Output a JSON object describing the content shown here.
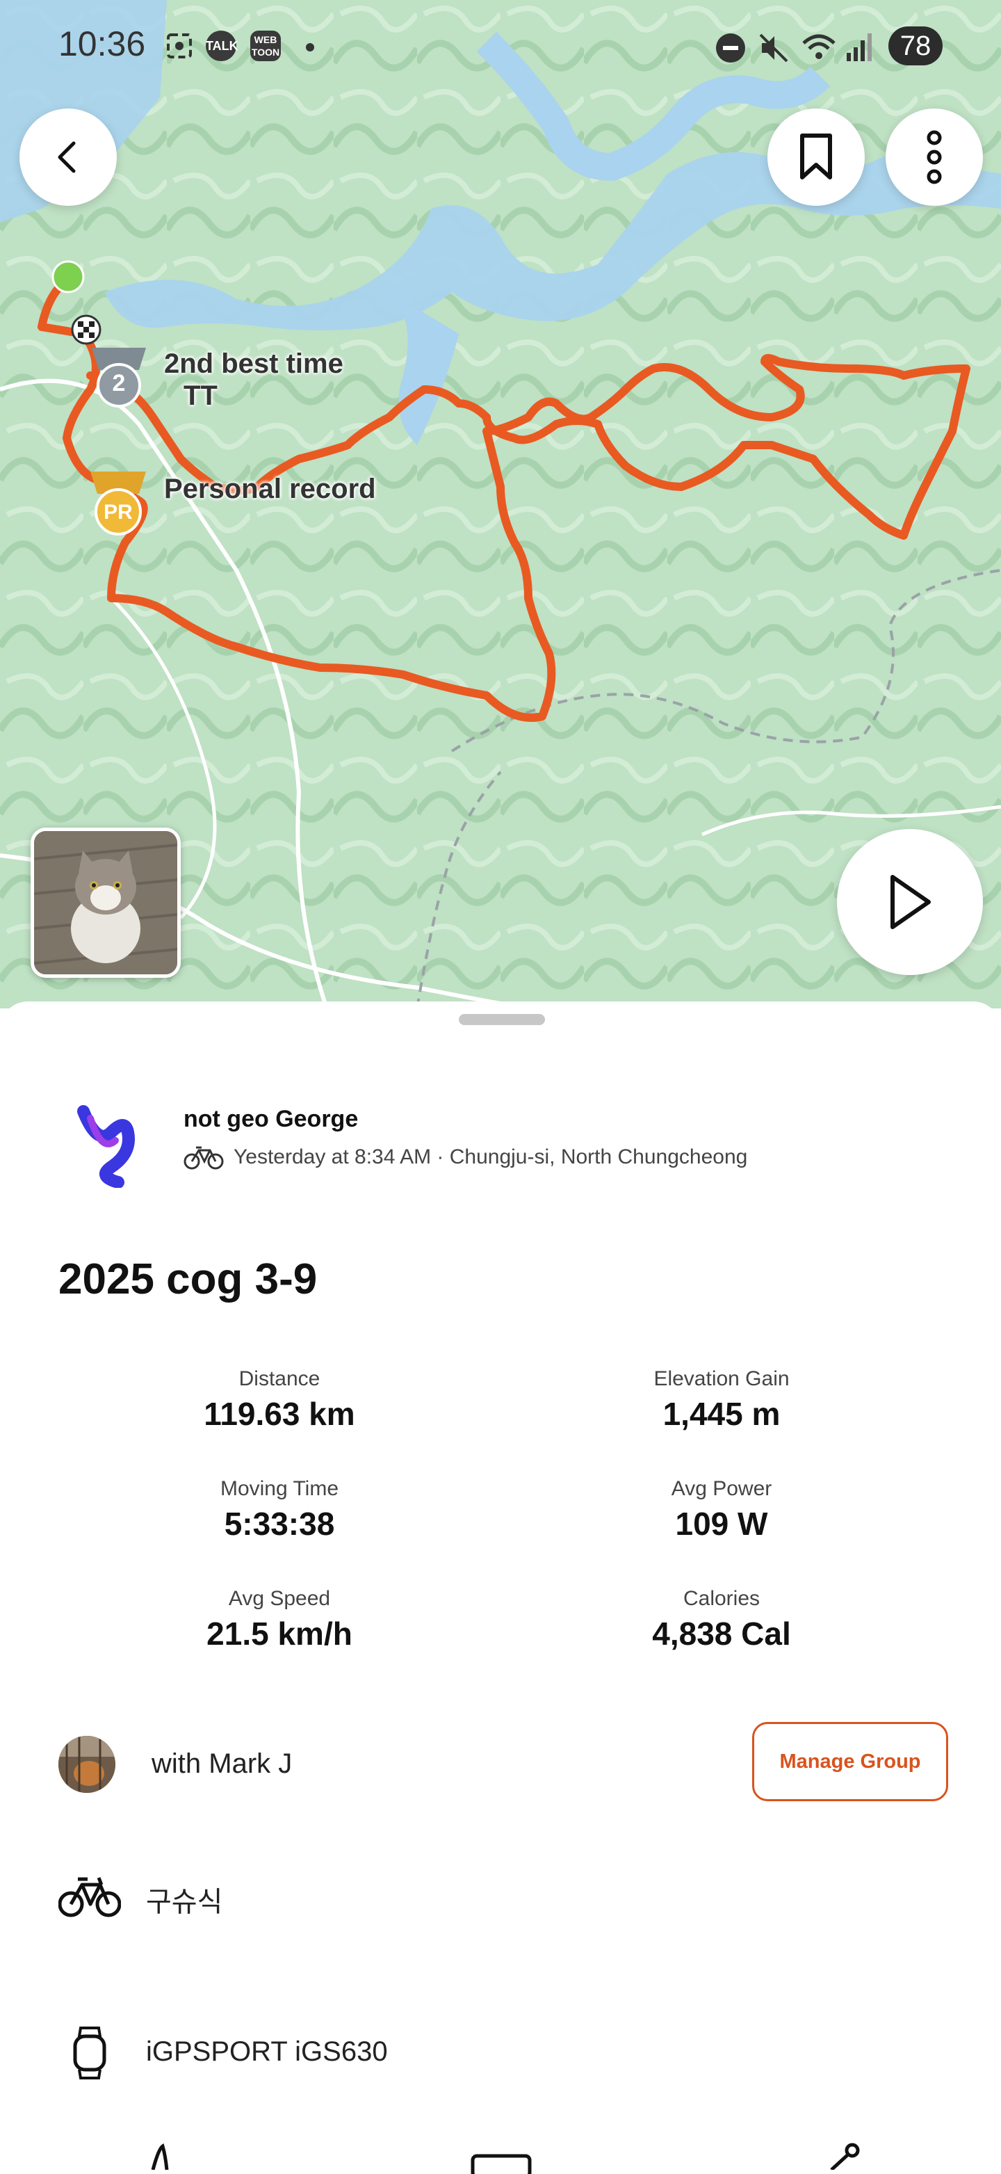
{
  "status_bar": {
    "time": "10:36",
    "battery": "78",
    "icons": [
      "screenshot-icon",
      "talk-icon",
      "webtoon-icon",
      "dot-icon",
      "dnd-icon",
      "mute-icon",
      "wifi-icon",
      "signal-icon"
    ],
    "talk_label": "TALK",
    "webtoon_label": "WEB TOON"
  },
  "map": {
    "back_icon": "chevron-left-icon",
    "bookmark_icon": "bookmark-icon",
    "more_icon": "more-vertical-icon",
    "play_icon": "play-icon",
    "label_best_time": "2nd best time\nTT",
    "label_best_time_line1": "2nd best time",
    "label_best_time_line2": "TT",
    "label_pr": "Personal record",
    "badge_2": "2",
    "badge_pr": "PR",
    "route_color": "#e85a22",
    "start_color": "#7ed04f"
  },
  "activity": {
    "athlete_name": "not geo George",
    "meta": "Yesterday at 8:34 AM · Chungju-si, North Chungcheong",
    "title": "2025 cog 3-9",
    "stats": [
      {
        "label": "Distance",
        "value": "119.63 km"
      },
      {
        "label": "Elevation Gain",
        "value": "1,445 m"
      },
      {
        "label": "Moving Time",
        "value": "5:33:38"
      },
      {
        "label": "Avg Power",
        "value": "109 W"
      },
      {
        "label": "Avg Speed",
        "value": "21.5 km/h"
      },
      {
        "label": "Calories",
        "value": "4,838 Cal"
      }
    ],
    "with_text": "with Mark J",
    "manage_group": "Manage Group",
    "bike": "구슈식",
    "device": "iGPSPORT iGS630"
  },
  "colors": {
    "accent": "#d9531e",
    "map_green": "#bfe1c4",
    "water": "#a9d3ee"
  }
}
